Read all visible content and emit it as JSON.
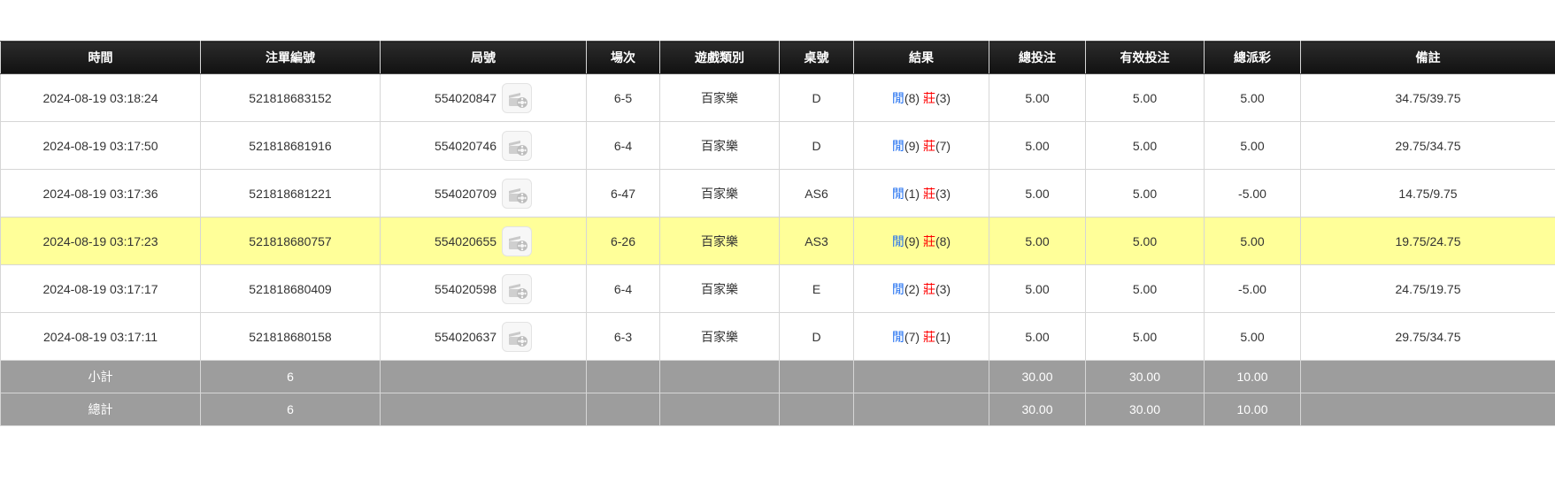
{
  "headers": {
    "time": "時間",
    "bet_no": "注單編號",
    "round": "局號",
    "session": "場次",
    "game_type": "遊戲類別",
    "table": "桌號",
    "result": "結果",
    "total_bet": "總投注",
    "valid_bet": "有效投注",
    "payout": "總派彩",
    "remark": "備註"
  },
  "colors": {
    "header_bg": "#1a1a1a",
    "highlight_row": "#ffff99",
    "summary_bg": "#9d9d9d",
    "player_blue": "#1f6ef0",
    "banker_red": "#ff0000"
  },
  "rows": [
    {
      "time": "2024-08-19 03:18:24",
      "bet_no": "521818683152",
      "round": "554020847",
      "session": "6-5",
      "game_type": "百家樂",
      "table": "D",
      "player_label": "閒",
      "player_score": "(8)",
      "banker_label": "莊",
      "banker_score": "(3)",
      "total_bet": "5.00",
      "valid_bet": "5.00",
      "payout": "5.00",
      "remark": "34.75/39.75"
    },
    {
      "time": "2024-08-19 03:17:50",
      "bet_no": "521818681916",
      "round": "554020746",
      "session": "6-4",
      "game_type": "百家樂",
      "table": "D",
      "player_label": "閒",
      "player_score": "(9)",
      "banker_label": "莊",
      "banker_score": "(7)",
      "total_bet": "5.00",
      "valid_bet": "5.00",
      "payout": "5.00",
      "remark": "29.75/34.75"
    },
    {
      "time": "2024-08-19 03:17:36",
      "bet_no": "521818681221",
      "round": "554020709",
      "session": "6-47",
      "game_type": "百家樂",
      "table": "AS6",
      "player_label": "閒",
      "player_score": "(1)",
      "banker_label": "莊",
      "banker_score": "(3)",
      "total_bet": "5.00",
      "valid_bet": "5.00",
      "payout": "-5.00",
      "remark": "14.75/9.75"
    },
    {
      "time": "2024-08-19 03:17:23",
      "bet_no": "521818680757",
      "round": "554020655",
      "session": "6-26",
      "game_type": "百家樂",
      "table": "AS3",
      "player_label": "閒",
      "player_score": "(9)",
      "banker_label": "莊",
      "banker_score": "(8)",
      "total_bet": "5.00",
      "valid_bet": "5.00",
      "payout": "5.00",
      "remark": "19.75/24.75"
    },
    {
      "time": "2024-08-19 03:17:17",
      "bet_no": "521818680409",
      "round": "554020598",
      "session": "6-4",
      "game_type": "百家樂",
      "table": "E",
      "player_label": "閒",
      "player_score": "(2)",
      "banker_label": "莊",
      "banker_score": "(3)",
      "total_bet": "5.00",
      "valid_bet": "5.00",
      "payout": "-5.00",
      "remark": "24.75/19.75"
    },
    {
      "time": "2024-08-19 03:17:11",
      "bet_no": "521818680158",
      "round": "554020637",
      "session": "6-3",
      "game_type": "百家樂",
      "table": "D",
      "player_label": "閒",
      "player_score": "(7)",
      "banker_label": "莊",
      "banker_score": "(1)",
      "total_bet": "5.00",
      "valid_bet": "5.00",
      "payout": "5.00",
      "remark": "29.75/34.75"
    }
  ],
  "subtotal": {
    "label": "小計",
    "count": "6",
    "total_bet": "30.00",
    "valid_bet": "30.00",
    "payout": "10.00"
  },
  "grand_total": {
    "label": "總計",
    "count": "6",
    "total_bet": "30.00",
    "valid_bet": "30.00",
    "payout": "10.00"
  }
}
